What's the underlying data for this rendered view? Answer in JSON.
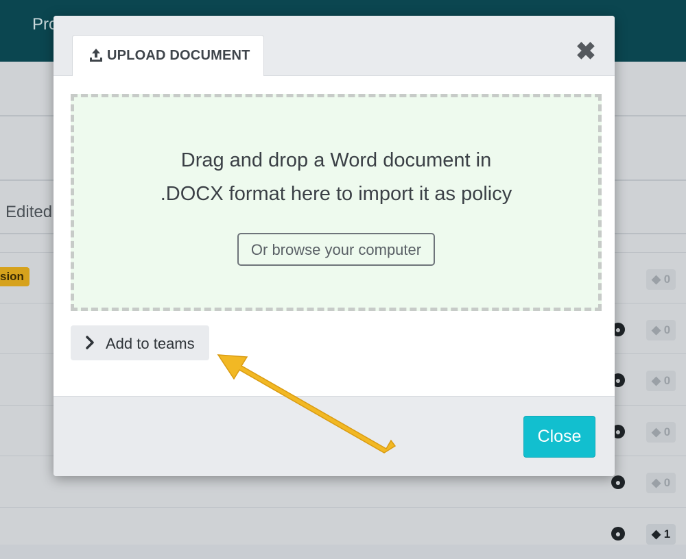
{
  "background": {
    "header_title": "Pro",
    "column_header": "Edited",
    "status_badge": "sion",
    "rows": [
      {
        "tag_count": "0",
        "has_globe": false
      },
      {
        "tag_count": "0",
        "has_globe": true
      },
      {
        "tag_count": "0",
        "has_globe": true
      },
      {
        "tag_count": "0",
        "has_globe": true
      },
      {
        "tag_count": "0",
        "has_globe": true
      },
      {
        "tag_count": "1",
        "has_globe": true
      }
    ]
  },
  "modal": {
    "tab_label": "UPLOAD DOCUMENT",
    "tab_icon": "upload-icon",
    "close_icon": "close-icon",
    "dropzone": {
      "line1": "Drag and drop a Word document in",
      "line2": ".DOCX format here to import it as policy",
      "browse_label": "Or browse your computer"
    },
    "teams_toggle": {
      "label": "Add to teams",
      "icon": "chevron-right-icon"
    },
    "footer": {
      "close_label": "Close"
    }
  },
  "annotation": {
    "arrow_color": "#f2b824"
  },
  "colors": {
    "header_bg": "#0b4650",
    "accent": "#12bfcf",
    "dropzone_bg": "#eefaee"
  }
}
